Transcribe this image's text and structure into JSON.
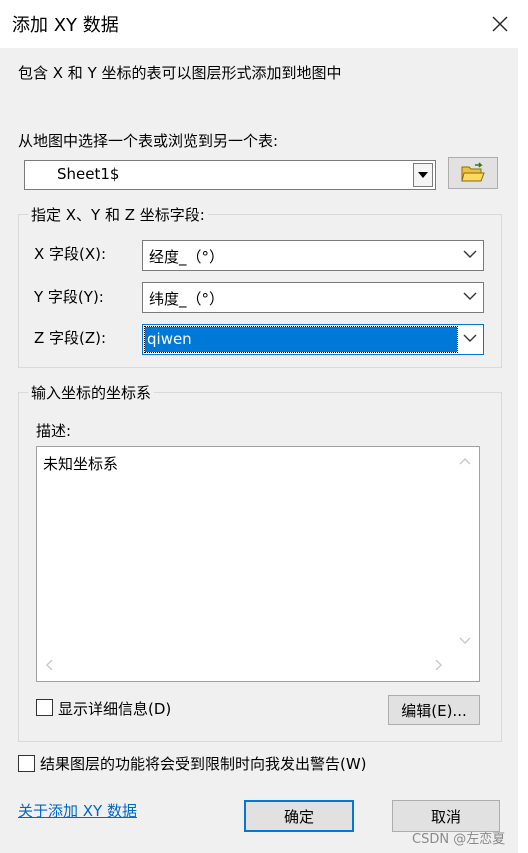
{
  "window": {
    "title": "添加 XY 数据"
  },
  "intro": "包含 X 和 Y 坐标的表可以图层形式添加到地图中",
  "table_prompt": "从地图中选择一个表或浏览到另一个表:",
  "table_select": {
    "value": "Sheet1$"
  },
  "fields_group": {
    "label": "指定 X、Y 和 Z 坐标字段:",
    "x": {
      "label": "X 字段(X):",
      "value": "经度_（°）"
    },
    "y": {
      "label": "Y 字段(Y):",
      "value": "纬度_（°）"
    },
    "z": {
      "label": "Z 字段(Z):",
      "value": "qiwen"
    }
  },
  "coord_group": {
    "label": "输入坐标的坐标系",
    "desc_label": "描述:",
    "description": "未知坐标系",
    "show_details_label": "显示详细信息(D)",
    "edit_button": "编辑(E)..."
  },
  "warn_label": "结果图层的功能将会受到限制时向我发出警告(W)",
  "about_link": "关于添加 XY 数据",
  "ok_button": "确定",
  "cancel_button": "取消",
  "watermark": "CSDN @左恋夏",
  "icons": {
    "close": "close-icon",
    "browse": "folder-open-icon",
    "dropdown": "chevron-down-icon"
  }
}
